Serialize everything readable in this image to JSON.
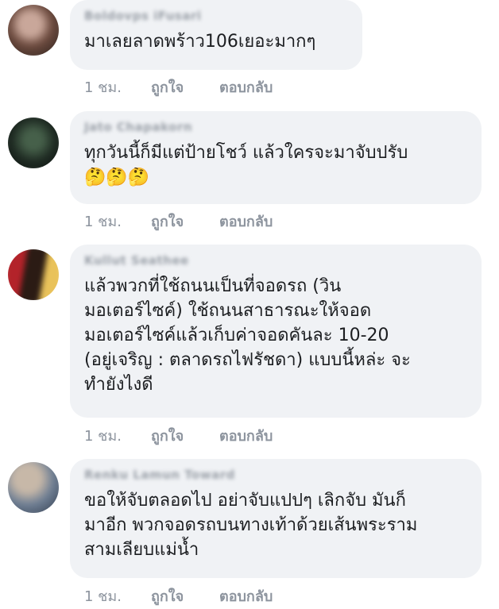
{
  "comments": [
    {
      "name": "Boldovps iFusari",
      "text": "มาเลยลาดพร้าว106เยอะมากๆ",
      "emoji": "",
      "time": "1 ชม.",
      "like": "ถูกใจ",
      "reply": "ตอบกลับ",
      "avatar_colors": [
        "#6d4b3f",
        "#c9a79a",
        "#3a2a24"
      ]
    },
    {
      "name": "Jato Chapakorn",
      "text": "ทุกวันนี้ก็มีแต่ป้ายโชว์ แล้วใครจะมาจับปรับ",
      "emoji": "🤔🤔🤔",
      "time": "1 ชม.",
      "like": "ถูกใจ",
      "reply": "ตอบกลับ",
      "avatar_colors": [
        "#1e2a22",
        "#46604a",
        "#0f1512"
      ]
    },
    {
      "name": "Kullut Seathee",
      "text": "แล้วพวกที่ใช้ถนนเป็นที่จอดรถ (วิน\nมอเตอร์ไซค์) ใช้ถนนสาธารณะให้จอด\nมอเตอร์ไซค์แล้วเก็บค่าจอดคันละ 10-20\n(อยู่เจริญ : ตลาดรถไฟรัชดา) แบบนี้หล่ะ จะ\nทำยังไงดี",
      "emoji": "",
      "time": "1 ชม.",
      "like": "ถูกใจ",
      "reply": "ตอบกลับ",
      "avatar_colors": [
        "#b3232a",
        "#e9c25a",
        "#2b1b14"
      ]
    },
    {
      "name": "Renku Lamun Toward",
      "text": "ขอให้จับตลอดไป อย่าจับแปปๆ เลิกจับ มันก็\nมาอีก พวกจอดรถบนทางเท้าด้วยเส้นพระราม\nสามเลียบแม่น้ำ",
      "emoji": "",
      "time": "1 ชม.",
      "like": "ถูกใจ",
      "reply": "ตอบกลับ",
      "avatar_colors": [
        "#6f7f94",
        "#c7b8a8",
        "#3b4657"
      ]
    }
  ]
}
